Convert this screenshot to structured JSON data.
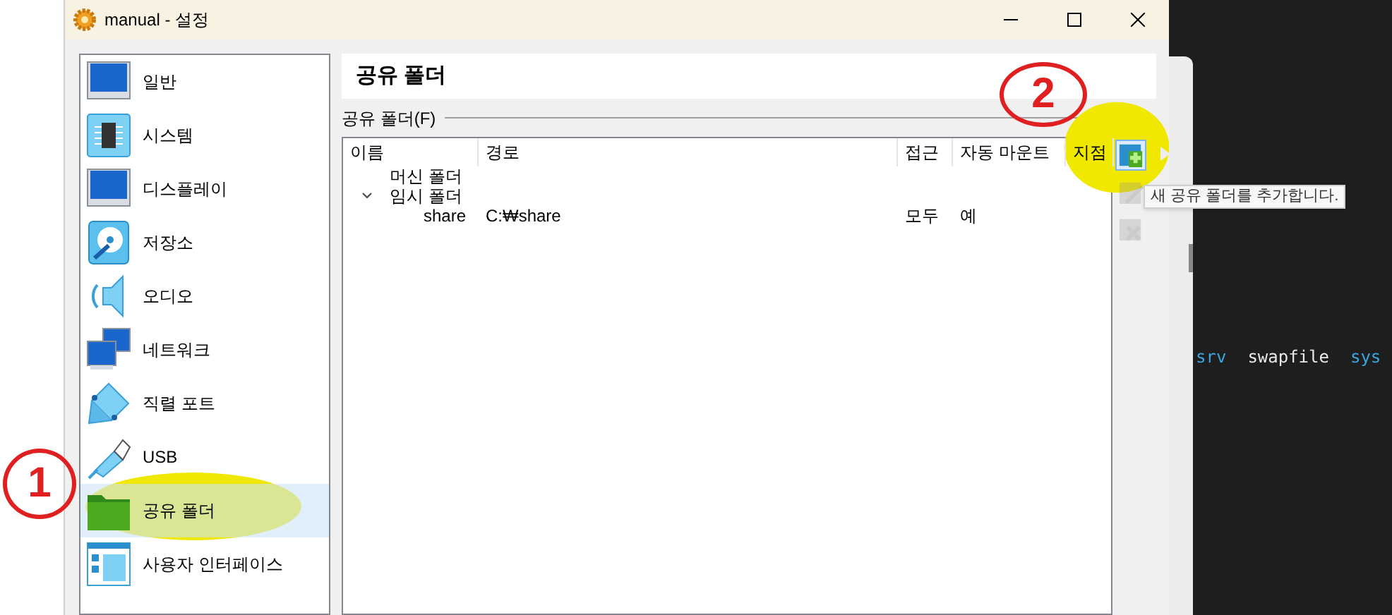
{
  "window": {
    "title": "manual - 설정"
  },
  "sidebar": {
    "items": [
      {
        "label": "일반",
        "selected": false
      },
      {
        "label": "시스템",
        "selected": false
      },
      {
        "label": "디스플레이",
        "selected": false
      },
      {
        "label": "저장소",
        "selected": false
      },
      {
        "label": "오디오",
        "selected": false
      },
      {
        "label": "네트워크",
        "selected": false
      },
      {
        "label": "직렬 포트",
        "selected": false
      },
      {
        "label": "USB",
        "selected": false
      },
      {
        "label": "공유 폴더",
        "selected": true
      },
      {
        "label": "사용자 인터페이스",
        "selected": false
      }
    ]
  },
  "page_header": "공유 폴더",
  "group_label": "공유 폴더(F)",
  "table": {
    "columns": [
      "이름",
      "경로",
      "접근",
      "자동 마운트",
      "지점"
    ],
    "rows": [
      {
        "name": "머신 폴더"
      },
      {
        "name": "임시 폴더",
        "expanded": true,
        "children": [
          {
            "name": "share",
            "path": "C:₩share",
            "access": "모두",
            "auto_mount": "예"
          }
        ]
      }
    ]
  },
  "toolbar": [
    {
      "kind": "add",
      "disabled": false
    },
    {
      "kind": "edit",
      "disabled": true
    },
    {
      "kind": "remove",
      "disabled": true
    }
  ],
  "tooltip": "새 공유 폴더를 추가합니다.",
  "terminal": {
    "words": [
      {
        "text": "srv",
        "kind": "dir"
      },
      {
        "text": "swapfile",
        "kind": "file"
      },
      {
        "text": "sys",
        "kind": "dir"
      }
    ]
  },
  "annotations": [
    {
      "label": "1"
    },
    {
      "label": "2"
    }
  ]
}
